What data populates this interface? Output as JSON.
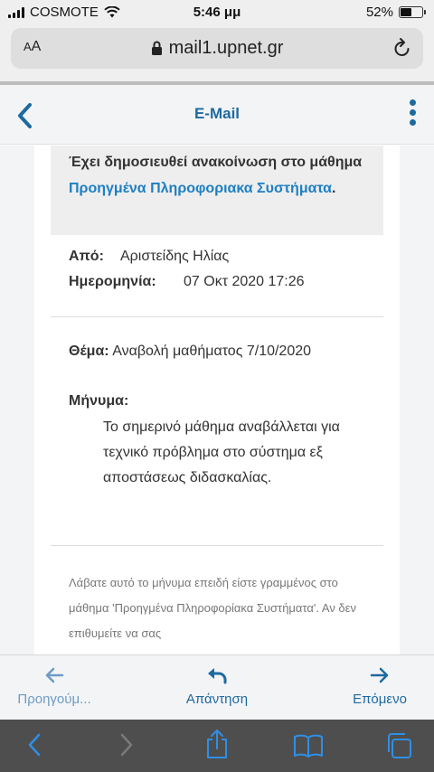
{
  "status_bar": {
    "carrier": "COSMOTE",
    "time": "5:46 μμ",
    "battery": "52%",
    "battery_level": 0.52
  },
  "browser": {
    "text_size_label_small": "A",
    "text_size_label_large": "A",
    "url": "mail1.upnet.gr"
  },
  "app_header": {
    "title": "E-Mail"
  },
  "notice": {
    "prefix": "Έχει δημοσιευθεί ανακοίνωση στο μάθημα ",
    "course": "Προηγμένα Πληροφοριακα Συστήματα",
    "suffix": "."
  },
  "meta": {
    "from_label": "Από:",
    "from_value": "Αριστείδης Ηλίας",
    "date_label": "Ημερομηνία:",
    "date_value": "07 Οκτ 2020 17:26"
  },
  "subject": {
    "label": "Θέμα:",
    "value": "Αναβολή μαθήματος 7/10/2020"
  },
  "message": {
    "label": "Μήνυμα:",
    "body": "Το σημερινό μάθημα αναβάλλεται για τεχνικό πρόβλημα στο σύστημα εξ αποστάσεως διδασκαλίας."
  },
  "footer_text": "Λάβατε αυτό το μήνυμα επειδή είστε γραμμένος στο μάθημα 'Προηγμένα Πληροφορίακα Συστήματα'. Αν δεν επιθυμείτε να σας",
  "app_nav": {
    "prev": "Προηγούμ...",
    "reply": "Απάντηση",
    "next": "Επόμενο"
  },
  "colors": {
    "accent": "#1e6aa0",
    "link": "#1e7fc2",
    "disabled": "#6d9bc5"
  }
}
